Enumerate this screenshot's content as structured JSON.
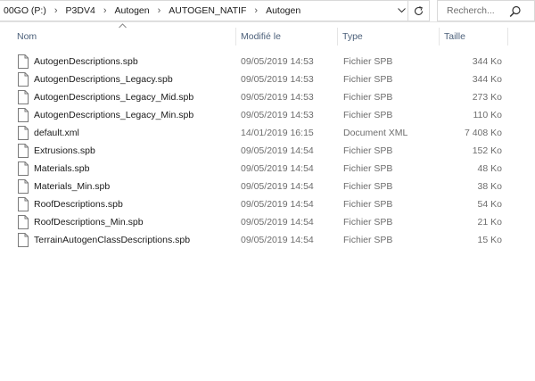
{
  "address_bar": {
    "crumbs": [
      "00GO (P:)",
      "P3DV4",
      "Autogen",
      "AUTOGEN_NATIF",
      "Autogen"
    ]
  },
  "search": {
    "placeholder": "Recherch..."
  },
  "columns": {
    "name": "Nom",
    "modified": "Modifié le",
    "type": "Type",
    "size": "Taille"
  },
  "files": [
    {
      "name": "AutogenDescriptions.spb",
      "modified": "09/05/2019 14:53",
      "type": "Fichier SPB",
      "size": "344 Ko"
    },
    {
      "name": "AutogenDescriptions_Legacy.spb",
      "modified": "09/05/2019 14:53",
      "type": "Fichier SPB",
      "size": "344 Ko"
    },
    {
      "name": "AutogenDescriptions_Legacy_Mid.spb",
      "modified": "09/05/2019 14:53",
      "type": "Fichier SPB",
      "size": "273 Ko"
    },
    {
      "name": "AutogenDescriptions_Legacy_Min.spb",
      "modified": "09/05/2019 14:53",
      "type": "Fichier SPB",
      "size": "110 Ko"
    },
    {
      "name": "default.xml",
      "modified": "14/01/2019 16:15",
      "type": "Document XML",
      "size": "7 408 Ko"
    },
    {
      "name": "Extrusions.spb",
      "modified": "09/05/2019 14:54",
      "type": "Fichier SPB",
      "size": "152 Ko"
    },
    {
      "name": "Materials.spb",
      "modified": "09/05/2019 14:54",
      "type": "Fichier SPB",
      "size": "48 Ko"
    },
    {
      "name": "Materials_Min.spb",
      "modified": "09/05/2019 14:54",
      "type": "Fichier SPB",
      "size": "38 Ko"
    },
    {
      "name": "RoofDescriptions.spb",
      "modified": "09/05/2019 14:54",
      "type": "Fichier SPB",
      "size": "54 Ko"
    },
    {
      "name": "RoofDescriptions_Min.spb",
      "modified": "09/05/2019 14:54",
      "type": "Fichier SPB",
      "size": "21 Ko"
    },
    {
      "name": "TerrainAutogenClassDescriptions.spb",
      "modified": "09/05/2019 14:54",
      "type": "Fichier SPB",
      "size": "15 Ko"
    }
  ],
  "icons": {
    "file": "file-icon",
    "search": "search-icon",
    "refresh": "refresh-icon",
    "dropdown": "chevron-down-icon",
    "sort": "sort-up-icon",
    "separator": "chevron-right-icon"
  },
  "colors": {
    "header_text": "#4c607a",
    "secondary_text": "#6d6d6d",
    "border": "#d9d9d9"
  }
}
